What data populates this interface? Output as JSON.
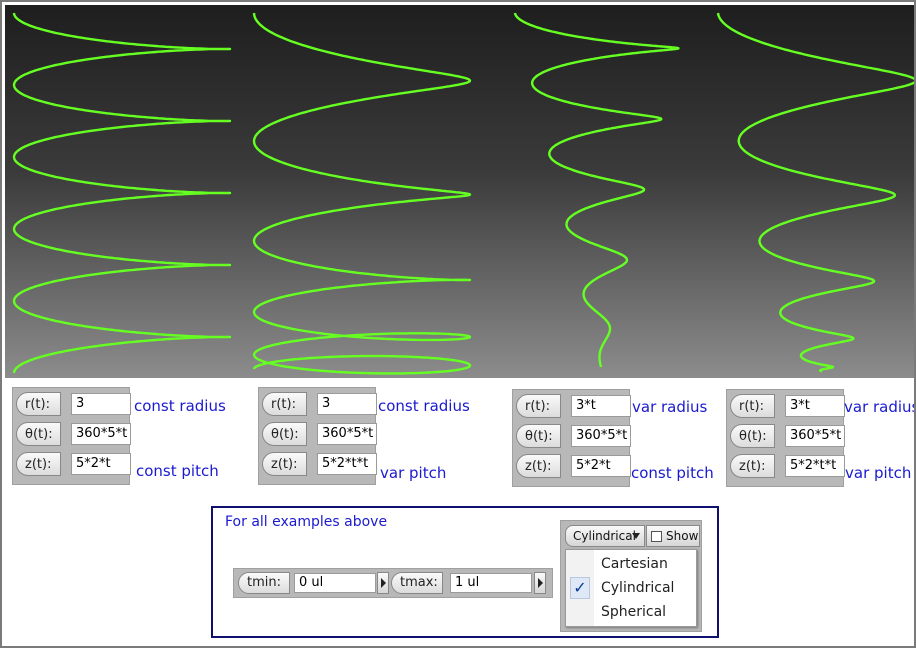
{
  "colors": {
    "curve": "#66ff22",
    "link_text": "#1a1ad0"
  },
  "examples": [
    {
      "r_label": "r(t):",
      "r_value": "3",
      "theta_label": "θ(t):",
      "theta_value": "360*5*t",
      "z_label": "z(t):",
      "z_value": "5*2*t",
      "radius_desc": "const radius",
      "pitch_desc": "const pitch"
    },
    {
      "r_label": "r(t):",
      "r_value": "3",
      "theta_label": "θ(t):",
      "theta_value": "360*5*t",
      "z_label": "z(t):",
      "z_value": "5*2*t*t",
      "radius_desc": "const radius",
      "pitch_desc": "var pitch"
    },
    {
      "r_label": "r(t):",
      "r_value": "3*t",
      "theta_label": "θ(t):",
      "theta_value": "360*5*t",
      "z_label": "z(t):",
      "z_value": "5*2*t",
      "radius_desc": "var radius",
      "pitch_desc": "const pitch"
    },
    {
      "r_label": "r(t):",
      "r_value": "3*t",
      "theta_label": "θ(t):",
      "theta_value": "360*5*t",
      "z_label": "z(t):",
      "z_value": "5*2*t*t",
      "radius_desc": "var radius",
      "pitch_desc": "var pitch"
    }
  ],
  "common": {
    "title": "For all examples above",
    "tmin_label": "tmin:",
    "tmin_value": "0 ul",
    "tmax_label": "tmax:",
    "tmax_value": "1 ul"
  },
  "coord_system": {
    "selected": "Cylindrical",
    "show_label": "Show",
    "show_checked": false,
    "options": [
      {
        "label": "Cartesian",
        "checked": false
      },
      {
        "label": "Cylindrical",
        "checked": true
      },
      {
        "label": "Spherical",
        "checked": false
      }
    ]
  }
}
